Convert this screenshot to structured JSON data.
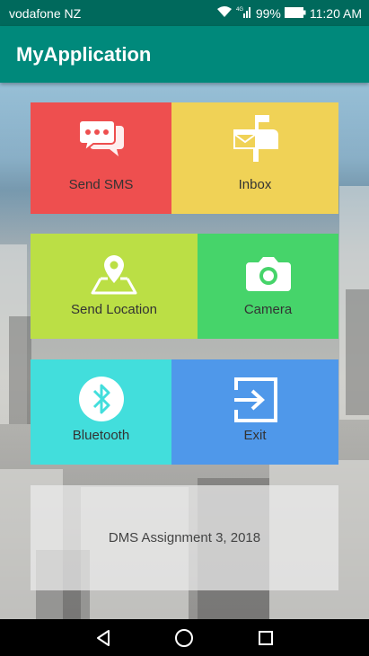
{
  "status_bar": {
    "carrier": "vodafone NZ",
    "signal_text": "4G",
    "battery": "99%",
    "time": "11:20 AM"
  },
  "app_bar": {
    "title": "MyApplication"
  },
  "tiles": [
    {
      "label": "Send SMS",
      "color": "#ee4f4f",
      "icon": "chat-bubbles-icon"
    },
    {
      "label": "Inbox",
      "color": "#f0d256",
      "icon": "mailbox-icon"
    },
    {
      "label": "Send Location",
      "color": "#bbdf45",
      "icon": "map-pin-icon"
    },
    {
      "label": "Camera",
      "color": "#46d46a",
      "icon": "camera-icon"
    },
    {
      "label": "Bluetooth",
      "color": "#42dedc",
      "icon": "bluetooth-icon"
    },
    {
      "label": "Exit",
      "color": "#4f98ea",
      "icon": "exit-icon"
    }
  ],
  "footer": {
    "text": "DMS Assignment 3, 2018"
  },
  "nav_bar": {
    "buttons": [
      "back-icon",
      "home-icon",
      "recents-icon"
    ]
  }
}
